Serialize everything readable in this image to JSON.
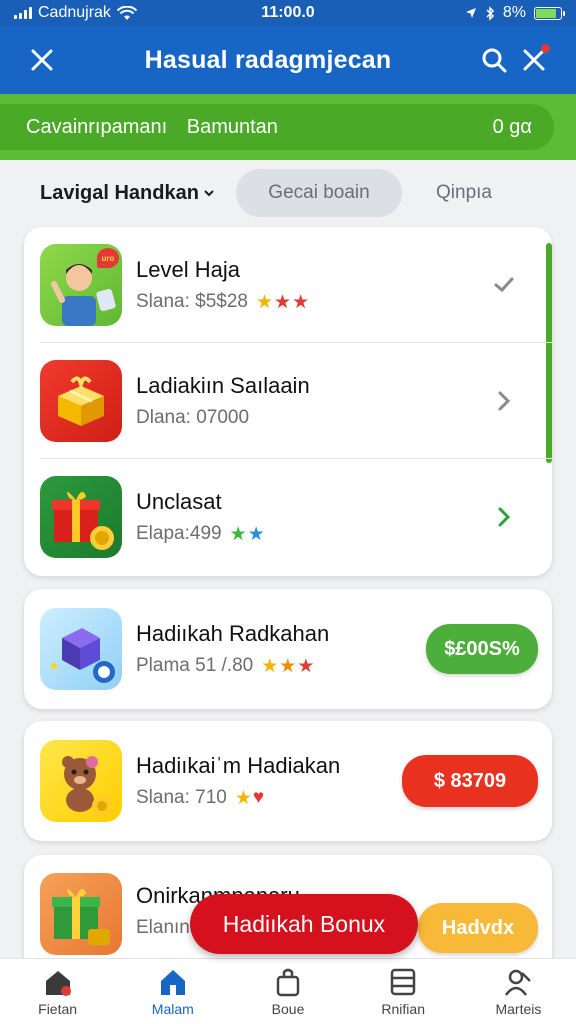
{
  "status_bar": {
    "carrier": "Cadnujrak",
    "time": "11:00.0",
    "battery": "8%"
  },
  "header": {
    "title": "Hasual radagmjecan"
  },
  "banner": {
    "text_left": "Cavainrıpamanı",
    "text_mid": "Bamuntan",
    "text_right": "0 gα"
  },
  "filters": {
    "select_label": "Lavigal Handkan",
    "chip_label": "Gecai boain",
    "plain_label": "Qinpıa"
  },
  "list_items": [
    {
      "title": "Level Haja",
      "subtitle": "Slana: $5$28",
      "stars": [
        "#f4b400",
        "#e53935",
        "#e53935"
      ],
      "thumb_colors": [
        "#8fd94b",
        "#5fb832"
      ],
      "badge": "uro",
      "action": "check"
    },
    {
      "title": "Ladiakiın Saılaain",
      "subtitle": "Dlana: 07000",
      "stars": [],
      "thumb_colors": [
        "#f03a2e",
        "#cf1f16"
      ],
      "action": "chevron"
    },
    {
      "title": "Unclasat",
      "subtitle": "Elapa:499",
      "stars": [
        "#3fb83a",
        "#2b8fe6"
      ],
      "thumb_colors": [
        "#2c9a3c",
        "#1d7a2c"
      ],
      "action": "chevron-green"
    }
  ],
  "cards": [
    {
      "title": "Hadiıkah Radkahan",
      "subtitle": "Plama 51 /.80",
      "stars": [
        "#f4b400",
        "#f08a00",
        "#e53935"
      ],
      "price": "$£00S%",
      "price_color": "#4caf3b",
      "thumb_colors": [
        "#bfe6ff",
        "#7ec8f4"
      ]
    },
    {
      "title": "Hadiıkaiˈm Hadiakan",
      "subtitle": "Slana: 710",
      "stars": [
        "#f4b400",
        "#e53935"
      ],
      "price": "$ 83709",
      "price_color": "#e8321f",
      "thumb_colors": [
        "#ffe23c",
        "#ffcd00"
      ]
    },
    {
      "title": "Onirkanmnanaru",
      "subtitle": "Elanın",
      "stars": [],
      "price": "Hadvdx",
      "price_color": "#f8b938",
      "thumb_colors": [
        "#f5a15a",
        "#e87830"
      ]
    }
  ],
  "fab": {
    "label": "Hadiıkah Bonux"
  },
  "nav": [
    {
      "label": "Fietan",
      "icon": "home-badge-icon",
      "active": false
    },
    {
      "label": "Malam",
      "icon": "home-icon",
      "active": true
    },
    {
      "label": "Boue",
      "icon": "gift-bag-icon",
      "active": false
    },
    {
      "label": "Rnifian",
      "icon": "list-icon",
      "active": false
    },
    {
      "label": "Marteis",
      "icon": "users-icon",
      "active": false
    }
  ],
  "colors": {
    "header_blue": "#1766c5",
    "banner_green": "#5dbb35",
    "accent_red": "#d4111c"
  }
}
